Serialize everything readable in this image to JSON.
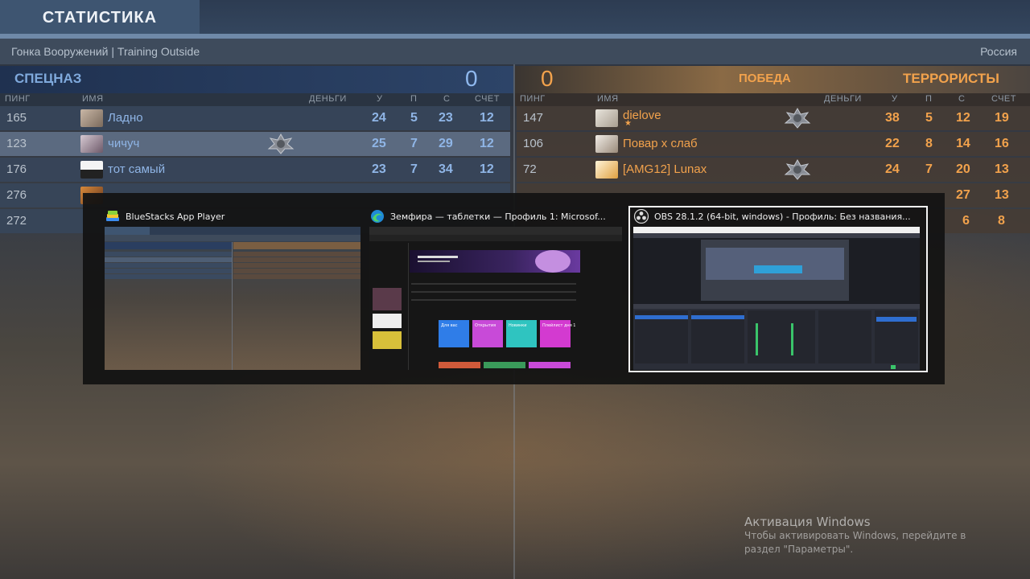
{
  "header": {
    "title": "СТАТИСТИКА"
  },
  "match": {
    "info": "Гонка Вооружений  |  Training Outside",
    "region": "Россия"
  },
  "ct_team": {
    "name": "СПЕЦНАЗ",
    "score": "0"
  },
  "t_team": {
    "name": "ТЕРРОРИСТЫ",
    "score": "0",
    "status": "ПОБЕДА"
  },
  "columns": {
    "ping": "ПИНГ",
    "name": "ИМЯ",
    "money": "ДЕНЬГИ",
    "kills": "У",
    "deaths": "П",
    "assists": "С",
    "score": "СЧЕТ"
  },
  "ct_players": [
    {
      "ping": "165",
      "name": "Ладно",
      "kills": "24",
      "deaths": "5",
      "assists": "23",
      "score": "12"
    },
    {
      "ping": "123",
      "name": "чичуч",
      "kills": "25",
      "deaths": "7",
      "assists": "29",
      "score": "12"
    },
    {
      "ping": "176",
      "name": "тот самый",
      "kills": "23",
      "deaths": "7",
      "assists": "34",
      "score": "12"
    },
    {
      "ping": "276"
    },
    {
      "ping": "272"
    }
  ],
  "t_players": [
    {
      "ping": "147",
      "name": "dielove",
      "star": "★",
      "kills": "38",
      "deaths": "5",
      "assists": "12",
      "score": "19"
    },
    {
      "ping": "106",
      "name": "Повар х слаб",
      "kills": "22",
      "deaths": "8",
      "assists": "14",
      "score": "16"
    },
    {
      "ping": "72",
      "name": "[AMG12] Lunax",
      "kills": "24",
      "deaths": "7",
      "assists": "20",
      "score": "13"
    },
    {
      "assists": "27",
      "score": "13"
    },
    {
      "assists": "6",
      "score": "8"
    }
  ],
  "switcher": {
    "windows": [
      {
        "title": "BlueStacks App Player",
        "icon": "bluestacks-icon"
      },
      {
        "title": "Земфира — таблетки — Профиль 1: Microsof...",
        "icon": "edge-icon"
      },
      {
        "title": "OBS 28.1.2 (64-bit, windows) - Профиль: Без названия...",
        "icon": "obs-icon"
      }
    ],
    "edge_cards": [
      "Для вас",
      "Открытия",
      "Новинки",
      "Плейлист дня 1"
    ]
  },
  "windows_activation": {
    "title": "Активация Windows",
    "text": "Чтобы активировать Windows, перейдите в раздел \"Параметры\"."
  }
}
